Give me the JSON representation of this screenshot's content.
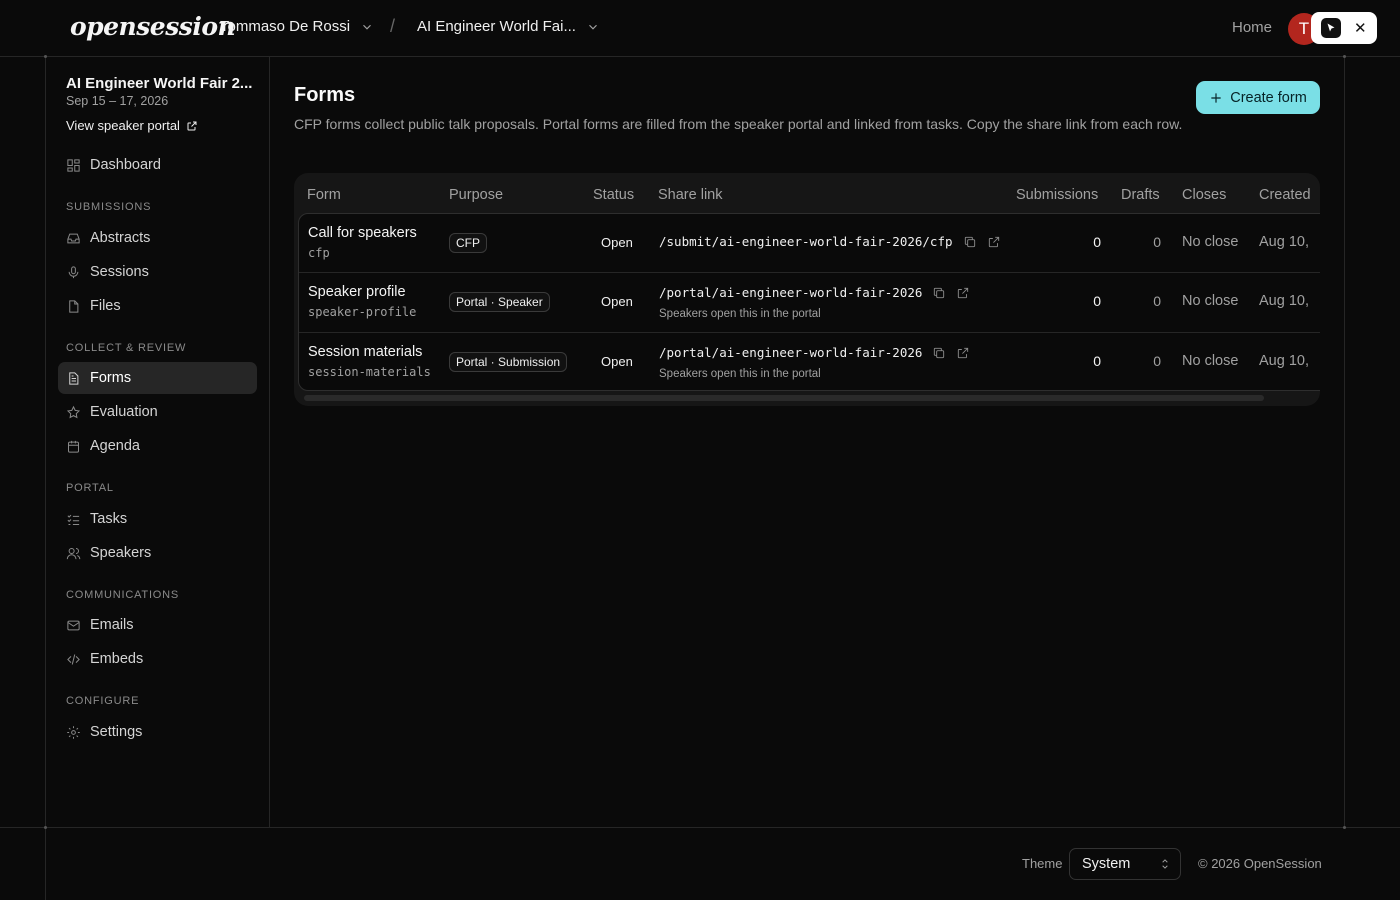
{
  "header": {
    "logo": "opensession",
    "user_name": "Tommaso De Rossi",
    "separator": "/",
    "event_name": "AI Engineer World Fai...",
    "home_label": "Home",
    "avatar_initial": "T",
    "close_symbol": "✕"
  },
  "sidebar": {
    "event_title": "AI Engineer World Fair 2...",
    "event_dates": "Sep 15 – 17, 2026",
    "portal_link": "View speaker portal",
    "dashboard": "Dashboard",
    "sections": {
      "submissions": "SUBMISSIONS",
      "collect": "COLLECT & REVIEW",
      "portal": "PORTAL",
      "communications": "COMMUNICATIONS",
      "configure": "CONFIGURE"
    },
    "items": {
      "abstracts": "Abstracts",
      "sessions": "Sessions",
      "files": "Files",
      "forms": "Forms",
      "evaluation": "Evaluation",
      "agenda": "Agenda",
      "tasks": "Tasks",
      "speakers": "Speakers",
      "emails": "Emails",
      "embeds": "Embeds",
      "settings": "Settings"
    }
  },
  "main": {
    "title": "Forms",
    "description": "CFP forms collect public talk proposals. Portal forms are filled from the speaker portal and linked from tasks. Copy the share link from each row.",
    "create_button": "Create form",
    "columns": {
      "form": "Form",
      "purpose": "Purpose",
      "status": "Status",
      "share_link": "Share link",
      "submissions": "Submissions",
      "drafts": "Drafts",
      "closes": "Closes",
      "created": "Created"
    },
    "rows": [
      {
        "name": "Call for speakers",
        "slug": "cfp",
        "purpose": "CFP",
        "status": "Open",
        "link": "/submit/ai-engineer-world-fair-2026/cfp",
        "note": "",
        "submissions": "0",
        "drafts": "0",
        "closes": "No close",
        "created": "Aug 10,"
      },
      {
        "name": "Speaker profile",
        "slug": "speaker-profile",
        "purpose": "Portal · Speaker",
        "status": "Open",
        "link": "/portal/ai-engineer-world-fair-2026",
        "note": "Speakers open this in the portal",
        "submissions": "0",
        "drafts": "0",
        "closes": "No close",
        "created": "Aug 10,"
      },
      {
        "name": "Session materials",
        "slug": "session-materials",
        "purpose": "Portal · Submission",
        "status": "Open",
        "link": "/portal/ai-engineer-world-fair-2026",
        "note": "Speakers open this in the portal",
        "submissions": "0",
        "drafts": "0",
        "closes": "No close",
        "created": "Aug 10,"
      }
    ]
  },
  "footer": {
    "theme_label": "Theme",
    "theme_value": "System",
    "copyright": "© 2026 OpenSession"
  },
  "colors": {
    "accent": "#7adfe6",
    "background": "#0a0a0a",
    "avatar": "#b3261e"
  }
}
